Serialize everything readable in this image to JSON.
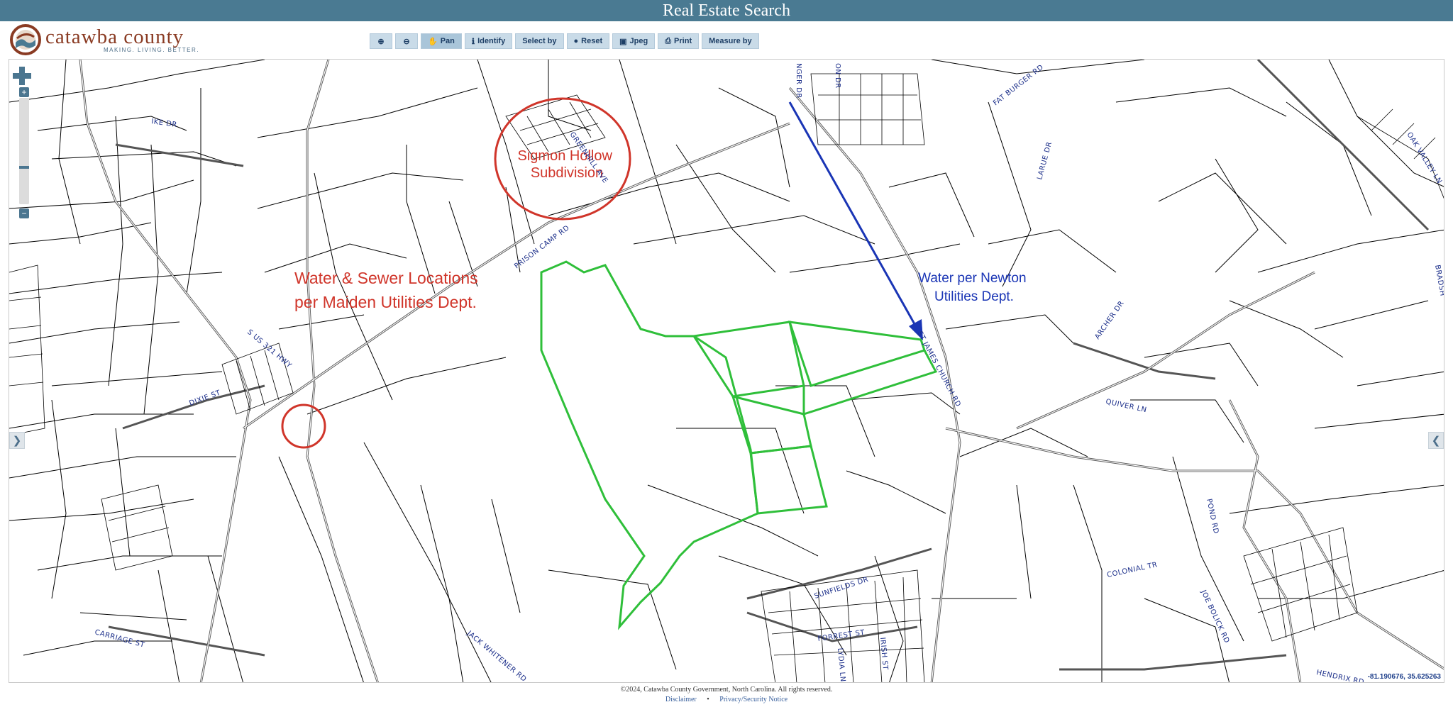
{
  "header": {
    "title": "Real Estate Search"
  },
  "logo": {
    "name": "catawba county",
    "tagline": "MAKING. LIVING. BETTER."
  },
  "toolbar": {
    "zoom_in_icon": "zoom-in-icon",
    "zoom_out_icon": "zoom-out-icon",
    "pan": "Pan",
    "identify": "Identify",
    "select_by": "Select by",
    "reset": "Reset",
    "jpeg": "Jpeg",
    "print": "Print",
    "measure_by": "Measure by"
  },
  "map": {
    "coordinates": "-81.190676, 35.625263",
    "annotations": {
      "subdivision": [
        "Sigmon Hollow",
        "Subdivision"
      ],
      "maiden_water": [
        "Water & Sewer Locations",
        "per Maiden Utilities Dept."
      ],
      "newton_water": [
        "Water per Newton",
        "Utilities Dept."
      ]
    },
    "annotation_colors": {
      "red": "#d0352a",
      "blue": "#1a35b5",
      "parcel_highlight": "#2fbf3a"
    },
    "street_labels": {
      "ike_dr": "IKE DR",
      "prison_camp_rd": "PRISON CAMP RD",
      "us_321": "S US 321 HWY",
      "dixie_st": "DIXIE ST",
      "st_james": "ST JAMES CHURCH RD",
      "fat_burger": "FAT BURGER RD",
      "larue": "LARUE DR",
      "oak_valley": "OAK VALLEY LN",
      "archer": "ARCHER DR",
      "quiver": "QUIVER LN",
      "pond": "POND RD",
      "colonial": "COLONIAL TR",
      "joe_bolick": "JOE BOLICK RD",
      "hendrix": "HENDRIX RD",
      "sunfields": "SUNFIELDS DR",
      "forrest": "FORREST ST",
      "lydia": "LYDIA LN",
      "irish": "IRISH ST",
      "carriage": "CARRIAGE ST",
      "jack_whitener": "JACK WHITENER RD",
      "greenhill": "GREENHILL AVE",
      "ringer": "NGER DR",
      "on_dr": "ON DR",
      "bradshaw": "BRADSH"
    }
  },
  "footer": {
    "copyright": "©2024, Catawba County Government, North Carolina. All rights reserved.",
    "disclaimer": "Disclaimer",
    "separator": "•",
    "privacy": "Privacy/Security Notice"
  }
}
